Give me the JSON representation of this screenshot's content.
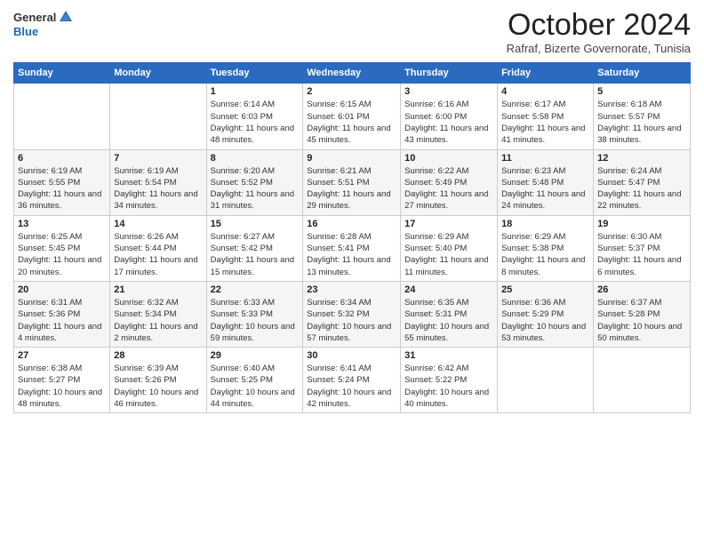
{
  "logo": {
    "text_general": "General",
    "text_blue": "Blue"
  },
  "header": {
    "month": "October 2024",
    "subtitle": "Rafraf, Bizerte Governorate, Tunisia"
  },
  "days_of_week": [
    "Sunday",
    "Monday",
    "Tuesday",
    "Wednesday",
    "Thursday",
    "Friday",
    "Saturday"
  ],
  "weeks": [
    [
      {
        "day": "",
        "detail": ""
      },
      {
        "day": "",
        "detail": ""
      },
      {
        "day": "1",
        "detail": "Sunrise: 6:14 AM\nSunset: 6:03 PM\nDaylight: 11 hours and 48 minutes."
      },
      {
        "day": "2",
        "detail": "Sunrise: 6:15 AM\nSunset: 6:01 PM\nDaylight: 11 hours and 45 minutes."
      },
      {
        "day": "3",
        "detail": "Sunrise: 6:16 AM\nSunset: 6:00 PM\nDaylight: 11 hours and 43 minutes."
      },
      {
        "day": "4",
        "detail": "Sunrise: 6:17 AM\nSunset: 5:58 PM\nDaylight: 11 hours and 41 minutes."
      },
      {
        "day": "5",
        "detail": "Sunrise: 6:18 AM\nSunset: 5:57 PM\nDaylight: 11 hours and 38 minutes."
      }
    ],
    [
      {
        "day": "6",
        "detail": "Sunrise: 6:19 AM\nSunset: 5:55 PM\nDaylight: 11 hours and 36 minutes."
      },
      {
        "day": "7",
        "detail": "Sunrise: 6:19 AM\nSunset: 5:54 PM\nDaylight: 11 hours and 34 minutes."
      },
      {
        "day": "8",
        "detail": "Sunrise: 6:20 AM\nSunset: 5:52 PM\nDaylight: 11 hours and 31 minutes."
      },
      {
        "day": "9",
        "detail": "Sunrise: 6:21 AM\nSunset: 5:51 PM\nDaylight: 11 hours and 29 minutes."
      },
      {
        "day": "10",
        "detail": "Sunrise: 6:22 AM\nSunset: 5:49 PM\nDaylight: 11 hours and 27 minutes."
      },
      {
        "day": "11",
        "detail": "Sunrise: 6:23 AM\nSunset: 5:48 PM\nDaylight: 11 hours and 24 minutes."
      },
      {
        "day": "12",
        "detail": "Sunrise: 6:24 AM\nSunset: 5:47 PM\nDaylight: 11 hours and 22 minutes."
      }
    ],
    [
      {
        "day": "13",
        "detail": "Sunrise: 6:25 AM\nSunset: 5:45 PM\nDaylight: 11 hours and 20 minutes."
      },
      {
        "day": "14",
        "detail": "Sunrise: 6:26 AM\nSunset: 5:44 PM\nDaylight: 11 hours and 17 minutes."
      },
      {
        "day": "15",
        "detail": "Sunrise: 6:27 AM\nSunset: 5:42 PM\nDaylight: 11 hours and 15 minutes."
      },
      {
        "day": "16",
        "detail": "Sunrise: 6:28 AM\nSunset: 5:41 PM\nDaylight: 11 hours and 13 minutes."
      },
      {
        "day": "17",
        "detail": "Sunrise: 6:29 AM\nSunset: 5:40 PM\nDaylight: 11 hours and 11 minutes."
      },
      {
        "day": "18",
        "detail": "Sunrise: 6:29 AM\nSunset: 5:38 PM\nDaylight: 11 hours and 8 minutes."
      },
      {
        "day": "19",
        "detail": "Sunrise: 6:30 AM\nSunset: 5:37 PM\nDaylight: 11 hours and 6 minutes."
      }
    ],
    [
      {
        "day": "20",
        "detail": "Sunrise: 6:31 AM\nSunset: 5:36 PM\nDaylight: 11 hours and 4 minutes."
      },
      {
        "day": "21",
        "detail": "Sunrise: 6:32 AM\nSunset: 5:34 PM\nDaylight: 11 hours and 2 minutes."
      },
      {
        "day": "22",
        "detail": "Sunrise: 6:33 AM\nSunset: 5:33 PM\nDaylight: 10 hours and 59 minutes."
      },
      {
        "day": "23",
        "detail": "Sunrise: 6:34 AM\nSunset: 5:32 PM\nDaylight: 10 hours and 57 minutes."
      },
      {
        "day": "24",
        "detail": "Sunrise: 6:35 AM\nSunset: 5:31 PM\nDaylight: 10 hours and 55 minutes."
      },
      {
        "day": "25",
        "detail": "Sunrise: 6:36 AM\nSunset: 5:29 PM\nDaylight: 10 hours and 53 minutes."
      },
      {
        "day": "26",
        "detail": "Sunrise: 6:37 AM\nSunset: 5:28 PM\nDaylight: 10 hours and 50 minutes."
      }
    ],
    [
      {
        "day": "27",
        "detail": "Sunrise: 6:38 AM\nSunset: 5:27 PM\nDaylight: 10 hours and 48 minutes."
      },
      {
        "day": "28",
        "detail": "Sunrise: 6:39 AM\nSunset: 5:26 PM\nDaylight: 10 hours and 46 minutes."
      },
      {
        "day": "29",
        "detail": "Sunrise: 6:40 AM\nSunset: 5:25 PM\nDaylight: 10 hours and 44 minutes."
      },
      {
        "day": "30",
        "detail": "Sunrise: 6:41 AM\nSunset: 5:24 PM\nDaylight: 10 hours and 42 minutes."
      },
      {
        "day": "31",
        "detail": "Sunrise: 6:42 AM\nSunset: 5:22 PM\nDaylight: 10 hours and 40 minutes."
      },
      {
        "day": "",
        "detail": ""
      },
      {
        "day": "",
        "detail": ""
      }
    ]
  ]
}
